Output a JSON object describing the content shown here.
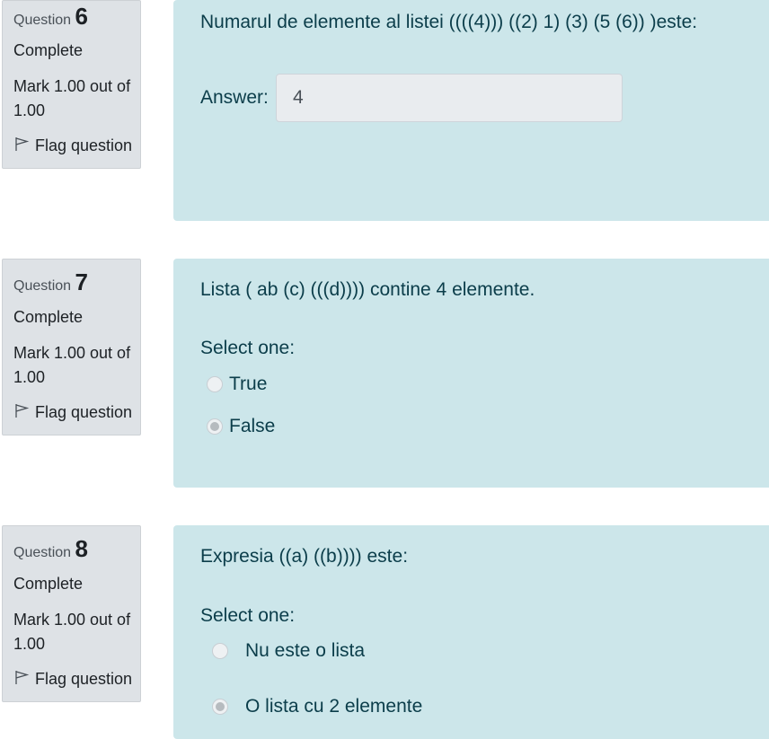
{
  "questions": [
    {
      "question_word": "Question",
      "number": "6",
      "state": "Complete",
      "grade": "Mark 1.00 out of 1.00",
      "flag_label": "Flag question",
      "text": "Numarul de elemente al listei  ((((4))) ((2) 1) (3) (5 (6)) )este:",
      "answer_label": "Answer:",
      "answer_value": "4"
    },
    {
      "question_word": "Question",
      "number": "7",
      "state": "Complete",
      "grade": "Mark 1.00 out of 1.00",
      "flag_label": "Flag question",
      "text": "Lista  ( ab (c) (((d)))) contine 4 elemente.",
      "prompt": "Select one:",
      "options": [
        {
          "label": "True",
          "selected": false
        },
        {
          "label": "False",
          "selected": true
        }
      ]
    },
    {
      "question_word": "Question",
      "number": "8",
      "state": "Complete",
      "grade": "Mark 1.00 out of 1.00",
      "flag_label": "Flag question",
      "text": "Expresia ((a) ((b)))) este:",
      "prompt": "Select one:",
      "options": [
        {
          "label": "Nu este o lista",
          "selected": false
        },
        {
          "label": "O lista cu 2 elemente",
          "selected": true
        }
      ]
    }
  ],
  "colors": {
    "info_bg": "#dee2e6",
    "content_bg": "#cce6ea",
    "question_text": "#0b3d4a"
  },
  "icons": {
    "flag": "flag-outline-icon"
  }
}
